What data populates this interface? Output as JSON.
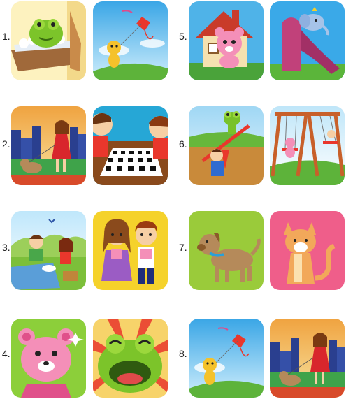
{
  "rows": [
    {
      "label": "1."
    },
    {
      "label": "2."
    },
    {
      "label": "3."
    },
    {
      "label": "4."
    },
    {
      "label": "5."
    },
    {
      "label": "6."
    },
    {
      "label": "7."
    },
    {
      "label": "8."
    }
  ],
  "pictures": [
    "frog-in-bathtub",
    "bear-flying-kite",
    "girl-walking-dog",
    "children-playing-checkers",
    "family-picnic",
    "children-holding-cards",
    "pink-bear-face",
    "frog-face",
    "bear-at-house",
    "elephant-slide",
    "frog-on-seesaw",
    "bear-on-swing",
    "brown-dog",
    "orange-cat",
    "bear-flying-kite",
    "girl-walking-dog"
  ]
}
